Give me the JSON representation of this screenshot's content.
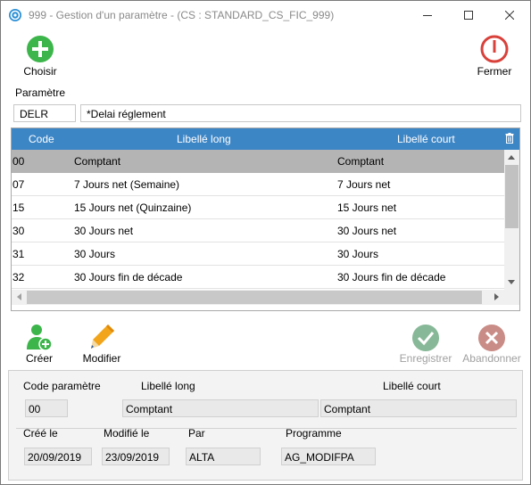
{
  "window": {
    "title": "999 - Gestion d'un paramètre - (CS : STANDARD_CS_FIC_999)"
  },
  "toolbar": {
    "choose_label": "Choisir",
    "close_label": "Fermer",
    "create_label": "Créer",
    "modify_label": "Modifier",
    "save_label": "Enregistrer",
    "cancel_label": "Abandonner"
  },
  "parameter": {
    "section_label": "Paramètre",
    "code": "DELR",
    "label": "*Delai réglement"
  },
  "grid": {
    "columns": [
      "Code",
      "Libellé long",
      "Libellé court"
    ],
    "rows": [
      {
        "code": "00",
        "long": "Comptant",
        "short": "Comptant"
      },
      {
        "code": "07",
        "long": "7 Jours net (Semaine)",
        "short": "7 Jours net"
      },
      {
        "code": "15",
        "long": "15 Jours net (Quinzaine)",
        "short": "15 Jours net"
      },
      {
        "code": "30",
        "long": "30 Jours net",
        "short": "30 Jours net"
      },
      {
        "code": "31",
        "long": "30 Jours",
        "short": "30 Jours"
      },
      {
        "code": "32",
        "long": "30 Jours fin de décade",
        "short": "30 Jours fin de décade"
      }
    ]
  },
  "details": {
    "code_label": "Code paramètre",
    "long_label": "Libellé long",
    "short_label": "Libellé court",
    "code_value": "00",
    "long_value": "Comptant",
    "short_value": "Comptant",
    "created_label": "Créé le",
    "modified_label": "Modifié le",
    "by_label": "Par",
    "program_label": "Programme",
    "created_value": "20/09/2019",
    "modified_value": "23/09/2019",
    "by_value": "ALTA",
    "program_value": "AG_MODIFPA"
  },
  "colors": {
    "header_blue": "#3d86c6",
    "green": "#3cb54a",
    "red": "#d9413b",
    "selected_row": "#b4b4b4"
  }
}
